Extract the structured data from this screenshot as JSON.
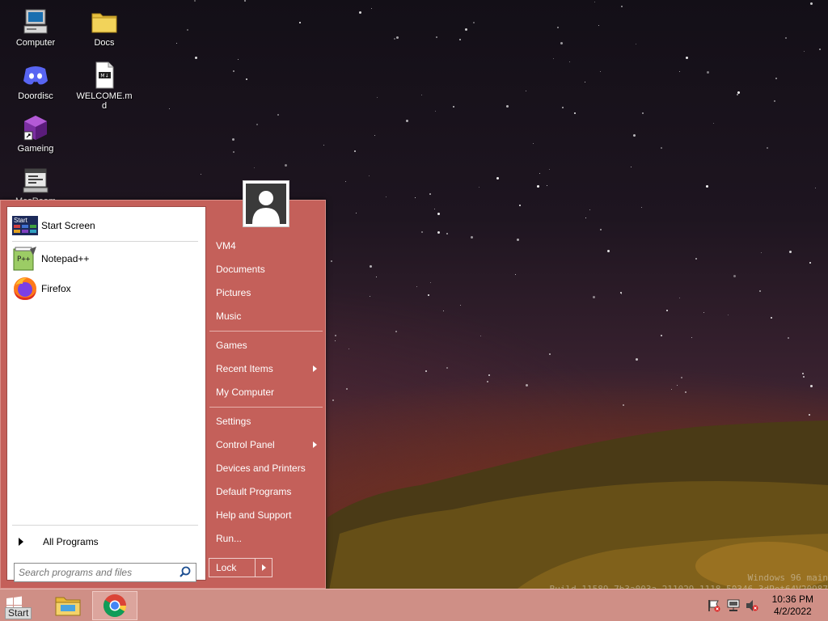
{
  "desktop": {
    "icons": [
      {
        "label": "Computer",
        "icon": "computer-icon"
      },
      {
        "label": "Docs",
        "icon": "folder-icon"
      },
      {
        "label": "Doordisc",
        "icon": "discord-icon"
      },
      {
        "label": "WELCOME.md",
        "icon": "markdown-file-icon"
      },
      {
        "label": "Gameing",
        "icon": "cube-shortcut-icon"
      },
      {
        "label": "MesRoom",
        "icon": "app-window-icon"
      }
    ]
  },
  "start_menu": {
    "pinned": [
      {
        "label": "Start Screen",
        "icon": "start-screen-icon"
      },
      {
        "label": "Notepad++",
        "icon": "notepad-plus-plus-icon"
      },
      {
        "label": "Firefox",
        "icon": "firefox-icon"
      }
    ],
    "all_programs_label": "All Programs",
    "search_placeholder": "Search programs and files",
    "right_items": [
      {
        "label": "VM4",
        "submenu": false
      },
      {
        "label": "Documents",
        "submenu": false
      },
      {
        "label": "Pictures",
        "submenu": false
      },
      {
        "label": "Music",
        "submenu": false
      },
      {
        "label": "Games",
        "submenu": false
      },
      {
        "label": "Recent Items",
        "submenu": true
      },
      {
        "label": "My Computer",
        "submenu": false
      },
      {
        "label": "Settings",
        "submenu": false
      },
      {
        "label": "Control Panel",
        "submenu": true
      },
      {
        "label": "Devices and Printers",
        "submenu": false
      },
      {
        "label": "Default Programs",
        "submenu": false
      },
      {
        "label": "Help and Support",
        "submenu": false
      },
      {
        "label": "Run...",
        "submenu": false
      }
    ],
    "lock_label": "Lock"
  },
  "watermark": {
    "line1": "Windows 96 main",
    "line2": "Build 11589.7b3a003a-211029-1118.50346 3dPet64V20987"
  },
  "taskbar": {
    "start_label": "Start",
    "pinned_apps": [
      {
        "name": "File Explorer",
        "icon": "file-explorer-icon",
        "active": false
      },
      {
        "name": "Chrome",
        "icon": "chrome-icon",
        "active": true
      }
    ],
    "time": "10:36 PM",
    "date": "4/2/2022"
  },
  "colors": {
    "menu_bg": "#c4605a",
    "taskbar_bg": "#cf8f86"
  }
}
